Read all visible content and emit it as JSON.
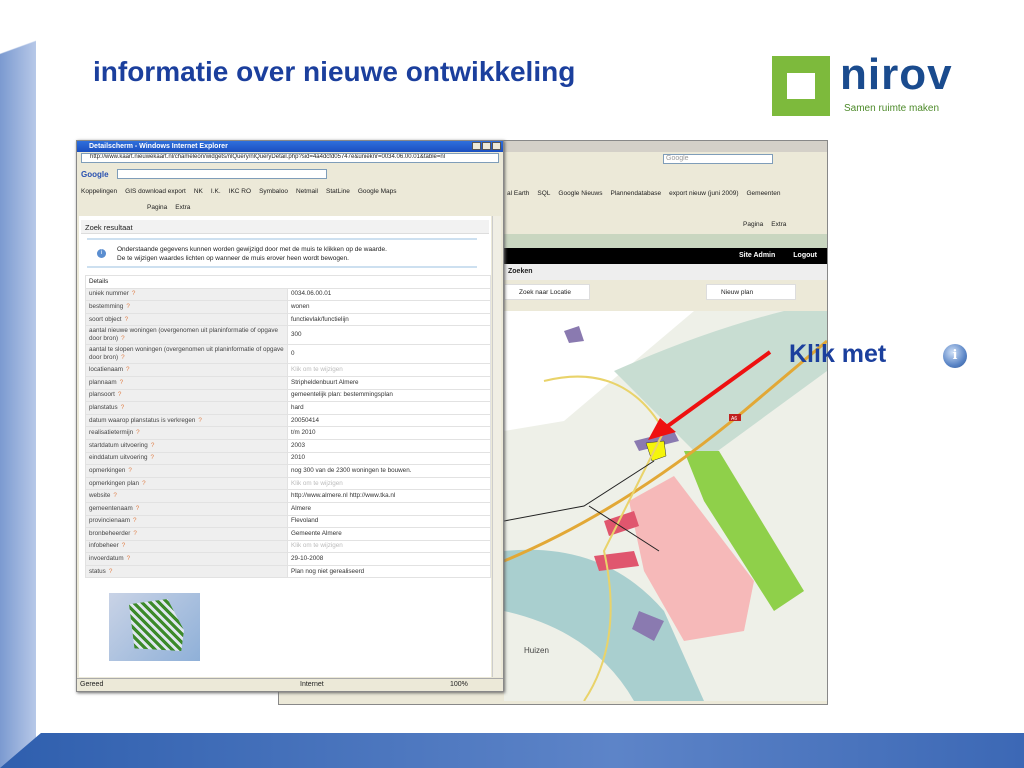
{
  "slide": {
    "title": "informatie over nieuwe ontwikkeling",
    "annotation": "Klik met",
    "annotation_icon": "info-icon"
  },
  "logo": {
    "brand": "nirov",
    "tagline": "Samen ruimte maken"
  },
  "bg_browser": {
    "search_placeholder": "Google",
    "favorites": [
      "al Earth",
      "SQL",
      "Google Nieuws",
      "Plannendatabase",
      "export nieuw (juni 2009)",
      "Gemeenten"
    ],
    "toolbar": [
      "Pagina",
      "Extra"
    ],
    "nav": [
      "Site Admin",
      "Logout"
    ],
    "section": "Zoeken",
    "buttons": [
      "Zoek naar Locatie",
      "Nieuw plan"
    ],
    "map_labels": [
      "A6",
      "Huizen"
    ]
  },
  "fg_browser": {
    "title": "Detailscherm - Windows Internet Explorer",
    "url": "http://www.kaart.nieuwekaart.nl/chameleon/widgets/nlQuery/nlQueryDetail.php?sid=4a4dcfd05747e&unieknr=0034.06.00.01&table=nl",
    "google_label": "Google",
    "links_label": "Koppelingen",
    "links": [
      "GIS download export",
      "NK",
      "I.K.",
      "IKC RO",
      "Symbaloo",
      "Netmail",
      "StatLine",
      "Google Maps"
    ],
    "toolbar": [
      "Pagina",
      "Extra"
    ],
    "section": "Zoek resultaat",
    "note": [
      "Onderstaande gegevens kunnen worden gewijzigd door met de muis te klikken op de waarde.",
      "De te wijzigen waardes lichten op wanneer de muis erover heen wordt bewogen."
    ],
    "details_header": "Details",
    "help_mark": "?",
    "rows": [
      {
        "label": "uniek nummer",
        "value": "0034.06.00.01"
      },
      {
        "label": "bestemming",
        "value": "wonen"
      },
      {
        "label": "soort object",
        "value": "functievlak/functielijn"
      },
      {
        "label": "aantal nieuwe woningen (overgenomen uit planinformatie of opgave door bron)",
        "value": "300"
      },
      {
        "label": "aantal te slopen woningen (overgenomen uit planinformatie of opgave door bron)",
        "value": "0"
      },
      {
        "label": "locatienaam",
        "value": "Klik om te wijzigen",
        "placeholder": true
      },
      {
        "label": "plannaam",
        "value": "Stripheldenbuurt Almere"
      },
      {
        "label": "plansoort",
        "value": "gemeentelijk plan: bestemmingsplan"
      },
      {
        "label": "planstatus",
        "value": "hard"
      },
      {
        "label": "datum waarop planstatus is verkregen",
        "value": "20050414"
      },
      {
        "label": "realisatietermijn",
        "value": "t/m 2010"
      },
      {
        "label": "startdatum uitvoering",
        "value": "2003"
      },
      {
        "label": "einddatum uitvoering",
        "value": "2010"
      },
      {
        "label": "opmerkingen",
        "value": "nog 300 van de 2300 woningen te bouwen."
      },
      {
        "label": "opmerkingen plan",
        "value": "Klik om te wijzigen",
        "placeholder": true
      },
      {
        "label": "website",
        "value": "http://www.almere.nl http://www.tka.nl"
      },
      {
        "label": "gemeentenaam",
        "value": "Almere"
      },
      {
        "label": "provincienaam",
        "value": "Flevoland"
      },
      {
        "label": "bronbeheerder",
        "value": "Gemeente Almere"
      },
      {
        "label": "infobeheer",
        "value": "Klik om te wijzigen",
        "placeholder": true
      },
      {
        "label": "invoerdatum",
        "value": "29-10-2008"
      },
      {
        "label": "status",
        "value": "Plan nog niet gerealiseerd"
      }
    ],
    "status": {
      "text": "Gereed",
      "zone": "Internet",
      "zoom": "100%"
    }
  }
}
